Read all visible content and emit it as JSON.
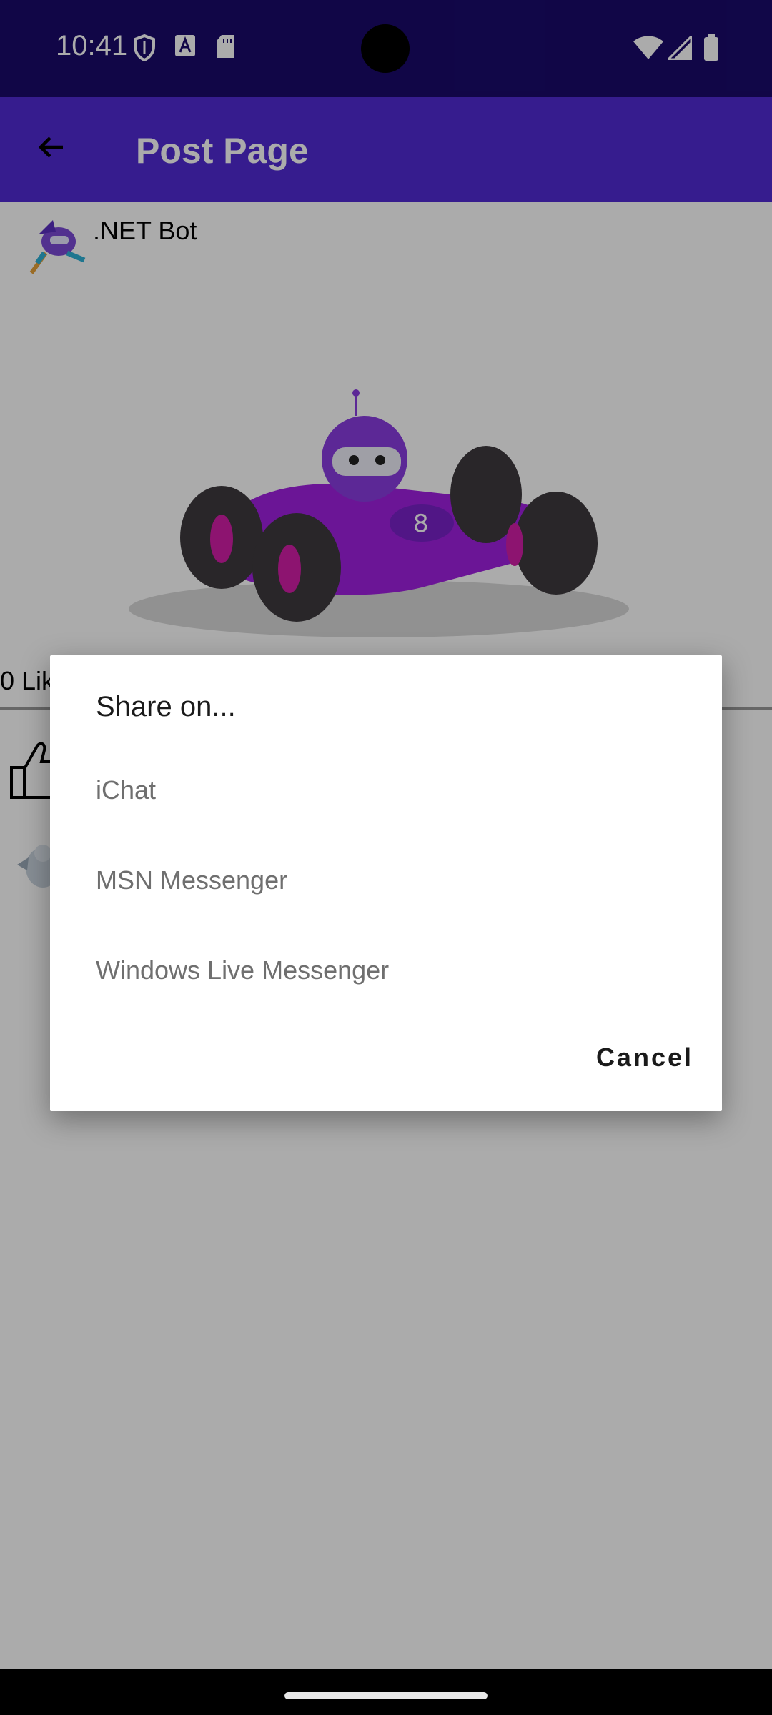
{
  "status_bar": {
    "time": "10:41",
    "icons": [
      "shield-icon",
      "a-badge-icon",
      "sd-card-icon",
      "wifi-icon",
      "signal-icon",
      "battery-icon"
    ]
  },
  "app_bar": {
    "title": "Post Page",
    "back_icon": "arrow-back-icon",
    "color": "#512bd4"
  },
  "post": {
    "author": ".NET Bot",
    "likes_text": "0 Lik",
    "image": "purple-race-car-bot"
  },
  "dialog": {
    "title": "Share on...",
    "options": [
      "iChat",
      "MSN Messenger",
      "Windows Live Messenger"
    ],
    "cancel_label": "Cancel"
  }
}
